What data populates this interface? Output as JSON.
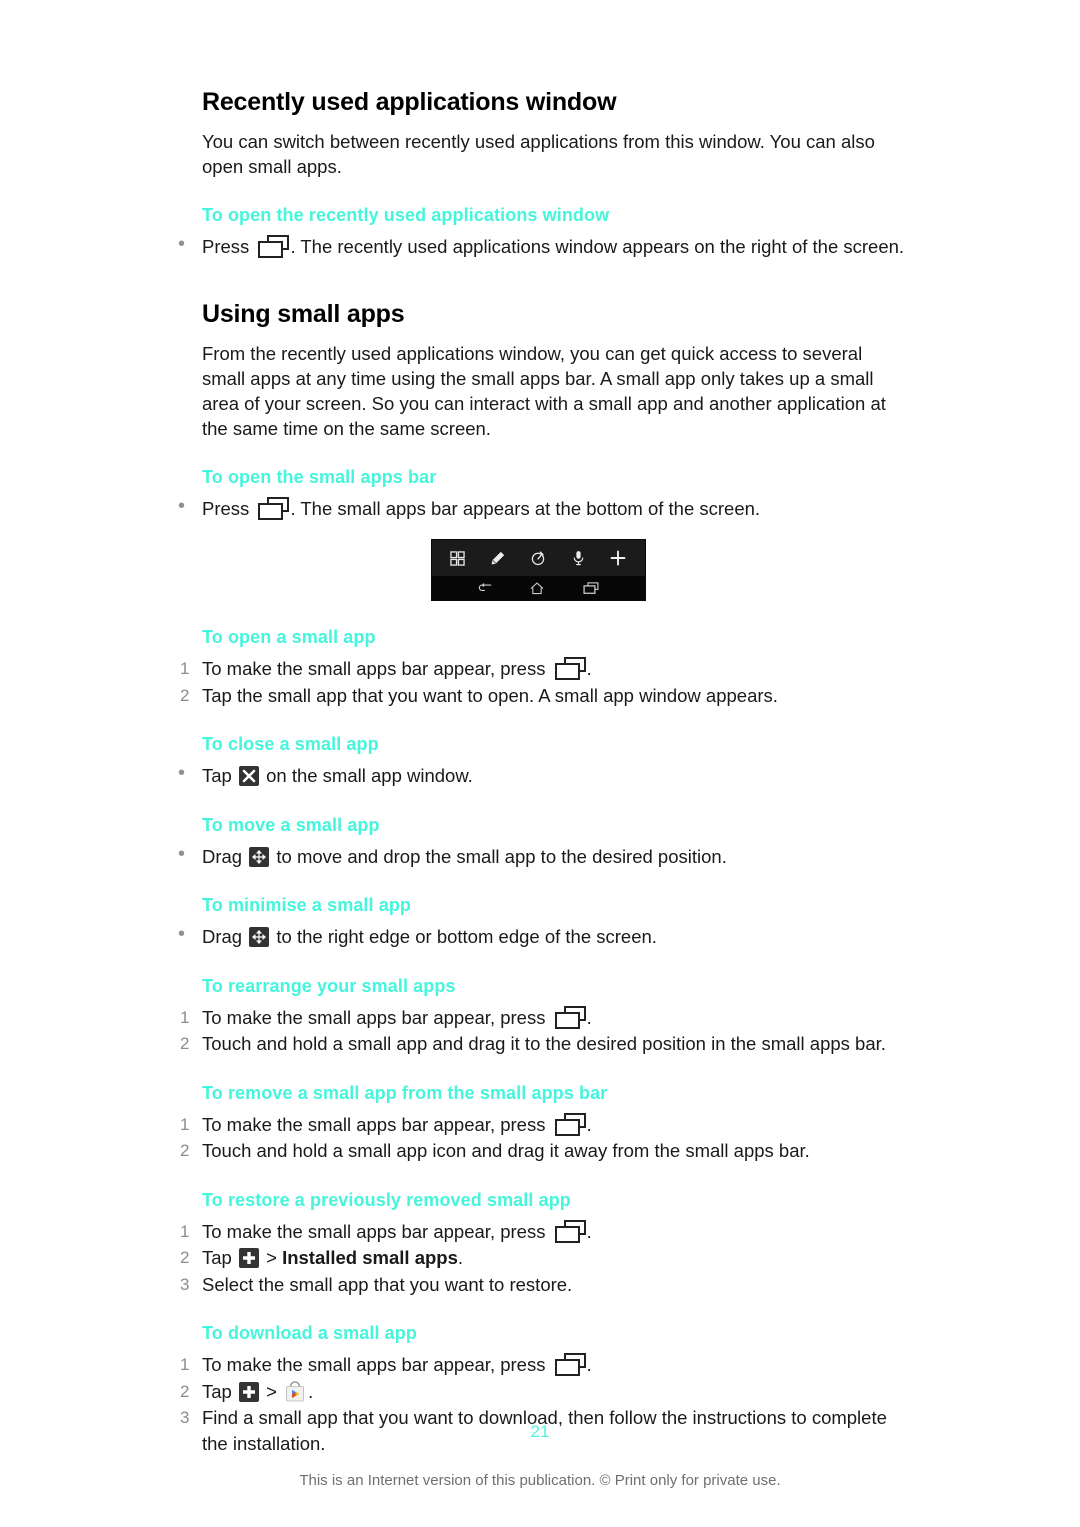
{
  "document": {
    "page_number": "21",
    "footer_note": "This is an Internet version of this publication. © Print only for private use.",
    "accent_color": "#45f5dc"
  },
  "sections": [
    {
      "title": "Recently used applications window",
      "intro": "You can switch between recently used applications from this window. You can also open small apps.",
      "subsections": [
        {
          "heading": "To open the recently used applications window",
          "items": [
            {
              "pre": "Press",
              "post": ". The recently used applications window appears on the right of the screen."
            }
          ]
        }
      ]
    },
    {
      "title": "Using small apps",
      "intro": "From the recently used applications window, you can get quick access to several small apps at any time using the small apps bar. A small app only takes up a small area of your screen. So you can interact with a small app and another application at the same time on the same screen.",
      "subsections": [
        {
          "heading": "To open the small apps bar",
          "items": [
            {
              "pre": "Press",
              "post": ". The small apps bar appears at the bottom of the screen."
            }
          ]
        }
      ]
    }
  ],
  "small_apps_bar_figure": {
    "top_row_icons": [
      "calculator-icon",
      "pen-icon",
      "timer-icon",
      "microphone-icon",
      "plus-icon"
    ],
    "bottom_row_icons": [
      "back-icon",
      "home-icon",
      "recents-icon"
    ],
    "background_top": "#1b1b1b",
    "background_bottom": "#060606"
  },
  "procedures": [
    {
      "heading": "To open a small app",
      "type": "numbered",
      "steps": [
        {
          "num": "1",
          "pre": "To make the small apps bar appear, press",
          "post": "."
        },
        {
          "num": "2",
          "text": "Tap the small app that you want to open. A small app window appears."
        }
      ]
    },
    {
      "heading": "To close a small app",
      "type": "bullet",
      "steps": [
        {
          "pre": "Tap",
          "post": "on the small app window.",
          "icon": "close-x-icon"
        }
      ]
    },
    {
      "heading": "To move a small app",
      "type": "bullet",
      "steps": [
        {
          "pre": "Drag",
          "post": "to move and drop the small app to the desired position.",
          "icon": "move-arrows-icon"
        }
      ]
    },
    {
      "heading": "To minimise a small app",
      "type": "bullet",
      "steps": [
        {
          "pre": "Drag",
          "post": "to the right edge or bottom edge of the screen.",
          "icon": "move-arrows-icon"
        }
      ]
    },
    {
      "heading": "To rearrange your small apps",
      "type": "numbered",
      "steps": [
        {
          "num": "1",
          "pre": "To make the small apps bar appear, press",
          "post": "."
        },
        {
          "num": "2",
          "text": "Touch and hold a small app and drag it to the desired position in the small apps bar."
        }
      ]
    },
    {
      "heading": "To remove a small app from the small apps bar",
      "type": "numbered",
      "steps": [
        {
          "num": "1",
          "pre": "To make the small apps bar appear, press",
          "post": "."
        },
        {
          "num": "2",
          "text": "Touch and hold a small app icon and drag it away from the small apps bar."
        }
      ]
    },
    {
      "heading": "To restore a previously removed small app",
      "type": "numbered",
      "steps": [
        {
          "num": "1",
          "pre": "To make the small apps bar appear, press",
          "post": "."
        },
        {
          "num": "2",
          "pre": "Tap",
          "mid": ">",
          "bold": "Installed small apps",
          "post": "."
        },
        {
          "num": "3",
          "text": "Select the small app that you want to restore."
        }
      ]
    },
    {
      "heading": "To download a small app",
      "type": "numbered",
      "steps": [
        {
          "num": "1",
          "pre": "To make the small apps bar appear, press",
          "post": "."
        },
        {
          "num": "2",
          "pre": "Tap",
          "mid": ">",
          "post": "."
        },
        {
          "num": "3",
          "text": "Find a small app that you want to download, then follow the instructions to complete the installation."
        }
      ]
    }
  ]
}
